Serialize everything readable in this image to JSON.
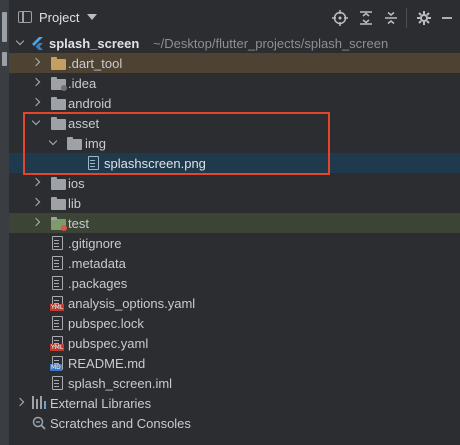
{
  "header": {
    "title": "Project",
    "tool_icons": [
      "crosshair-icon",
      "expand-all-icon",
      "collapse-all-icon",
      "gear-icon",
      "minimize-icon"
    ]
  },
  "tree": [
    {
      "label": "splash_screen",
      "path": "~/Desktop/flutter_projects/splash_screen",
      "icon": "flutter-icon",
      "expanded": true
    },
    {
      "label": ".dart_tool",
      "icon": "folder-icon",
      "expanded": false,
      "highlight": "excluded"
    },
    {
      "label": ".idea",
      "icon": "folder-icon",
      "expanded": false
    },
    {
      "label": "android",
      "icon": "folder-icon",
      "expanded": false
    },
    {
      "label": "asset",
      "icon": "folder-icon",
      "expanded": true
    },
    {
      "label": "img",
      "icon": "folder-icon",
      "expanded": true
    },
    {
      "label": "splashscreen.png",
      "icon": "image-file-icon",
      "highlight": "selected"
    },
    {
      "label": "ios",
      "icon": "folder-icon",
      "expanded": false
    },
    {
      "label": "lib",
      "icon": "folder-icon",
      "expanded": false
    },
    {
      "label": "test",
      "icon": "test-folder-icon",
      "expanded": false,
      "highlight": "test"
    },
    {
      "label": ".gitignore",
      "icon": "file-icon"
    },
    {
      "label": ".metadata",
      "icon": "file-icon"
    },
    {
      "label": ".packages",
      "icon": "file-icon"
    },
    {
      "label": "analysis_options.yaml",
      "icon": "yaml-file-icon"
    },
    {
      "label": "pubspec.lock",
      "icon": "file-icon"
    },
    {
      "label": "pubspec.yaml",
      "icon": "yaml-file-icon"
    },
    {
      "label": "README.md",
      "icon": "markdown-file-icon"
    },
    {
      "label": "splash_screen.iml",
      "icon": "iml-file-icon"
    },
    {
      "label": "External Libraries",
      "icon": "libraries-icon",
      "expanded": false
    },
    {
      "label": "Scratches and Consoles",
      "icon": "scratches-icon"
    }
  ],
  "colors": {
    "background": "#2b2d30",
    "excluded_row": "#4e4232",
    "selected_row": "#1e3a4c",
    "test_row": "#3b4435",
    "annotation_box": "#e4462b"
  }
}
